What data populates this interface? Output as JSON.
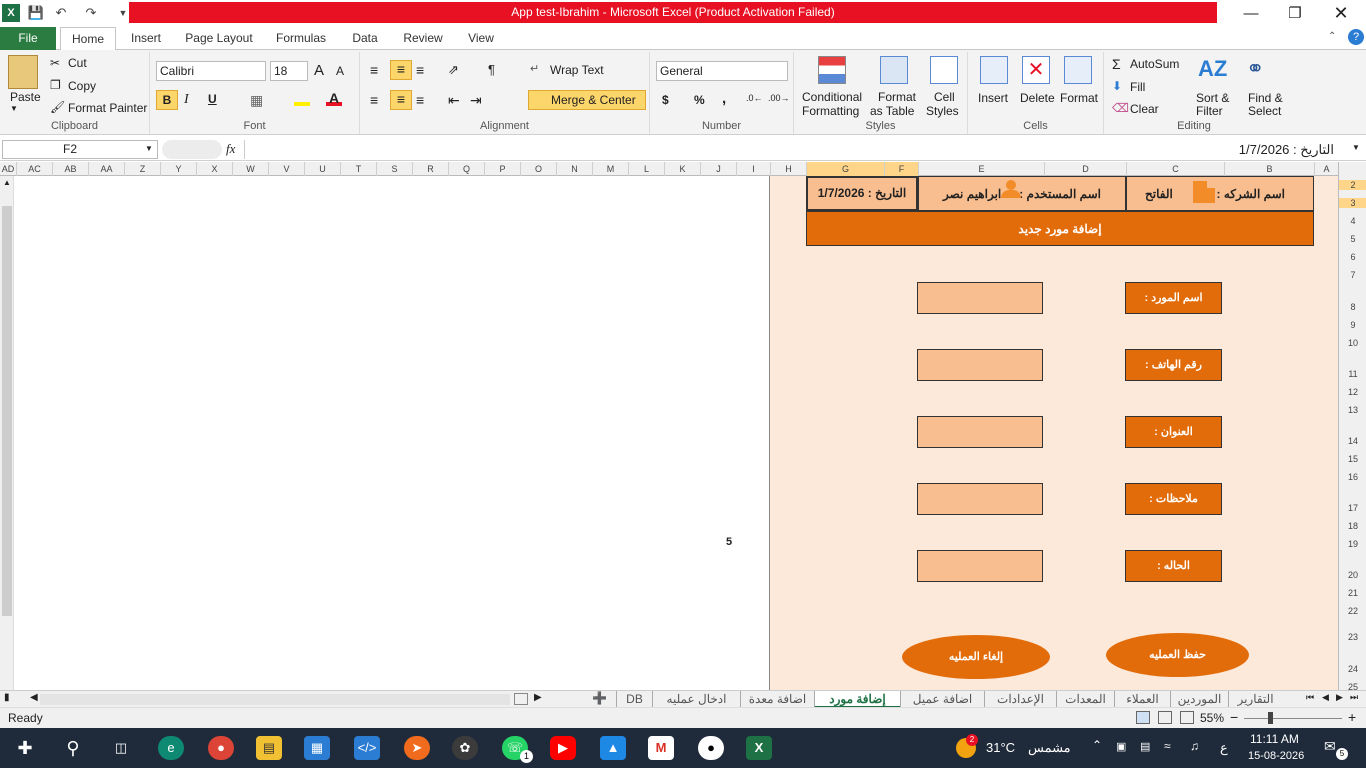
{
  "window": {
    "title": "App test-Ibrahim  -  Microsoft Excel (Product Activation Failed)"
  },
  "ribbon_tabs": [
    "File",
    "Home",
    "Insert",
    "Page Layout",
    "Formulas",
    "Data",
    "Review",
    "View"
  ],
  "clipboard": {
    "paste": "Paste",
    "cut": "Cut",
    "copy": "Copy",
    "format_painter": "Format Painter",
    "label": "Clipboard"
  },
  "font": {
    "name": "Calibri",
    "size": "18",
    "label": "Font",
    "bold": "B",
    "italic": "I",
    "underline": "U"
  },
  "alignment": {
    "wrap": "Wrap Text",
    "merge": "Merge & Center",
    "label": "Alignment"
  },
  "number": {
    "format": "General",
    "label": "Number",
    "currency": "$",
    "percent": "%",
    "comma": ","
  },
  "styles": {
    "conditional": "Conditional",
    "conditional2": "Formatting",
    "format_table": "Format",
    "format_table2": "as Table",
    "cell_styles": "Cell",
    "cell_styles2": "Styles",
    "label": "Styles"
  },
  "cells": {
    "insert": "Insert",
    "delete": "Delete",
    "format": "Format",
    "label": "Cells"
  },
  "editing": {
    "autosum": "AutoSum",
    "fill": "Fill",
    "clear": "Clear",
    "sort": "Sort &",
    "sort2": "Filter",
    "find": "Find &",
    "find2": "Select",
    "label": "Editing"
  },
  "formula_bar": {
    "name_box": "F2",
    "fx": "fx",
    "formula": "التاريخ : 1/7/2026"
  },
  "columns": [
    "AD",
    "AC",
    "AB",
    "AA",
    "Z",
    "Y",
    "X",
    "W",
    "V",
    "U",
    "T",
    "S",
    "R",
    "Q",
    "P",
    "O",
    "N",
    "M",
    "L",
    "K",
    "J",
    "I",
    "H",
    "G",
    "F",
    "E",
    "D",
    "C",
    "B",
    "A"
  ],
  "rows": [
    "2",
    "3",
    "4",
    "5",
    "6",
    "7",
    "8",
    "9",
    "10",
    "11",
    "12",
    "13",
    "14",
    "15",
    "16",
    "17",
    "18",
    "19",
    "20",
    "21",
    "22",
    "23",
    "24",
    "25"
  ],
  "sheet": {
    "company_label": "اسم الشركه :",
    "company_name": "الفاتح",
    "user_label": "اسم المستخدم :",
    "user_name": "ابراهيم نصر",
    "date": "التاريخ : 1/7/2026",
    "form_title": "إضافة مورد جديد",
    "fields": [
      "اسم المورد :",
      "رقم الهاتف :",
      "العنوان :",
      "ملاحظات :",
      "الحاله :"
    ],
    "save_button": "حفظ العمليه",
    "cancel_button": "إلغاء العمليه",
    "stray_value": "5"
  },
  "sheet_tabs": [
    "التقارير",
    "الموردين",
    "العملاء",
    "المعدات",
    "الإعدادات",
    "اضافة عميل",
    "إضافة مورد",
    "اضافة معدة",
    "ادخال عمليه",
    "DB"
  ],
  "active_sheet": "إضافة مورد",
  "status": {
    "ready": "Ready",
    "zoom": "55%"
  },
  "taskbar": {
    "temperature": "31°C",
    "weather": "مشمس",
    "time": "11:11 AM",
    "date": "15-08-2026",
    "lang": "ع",
    "notifications": "5",
    "whatsapp_badge": "1",
    "weather_badge": "2"
  },
  "colors": {
    "accent_orange": "#e36c0a",
    "peach": "#f9be8f",
    "sheet_bg": "#fde9d9",
    "excel_green": "#2a7c40",
    "title_red": "#e81123"
  }
}
